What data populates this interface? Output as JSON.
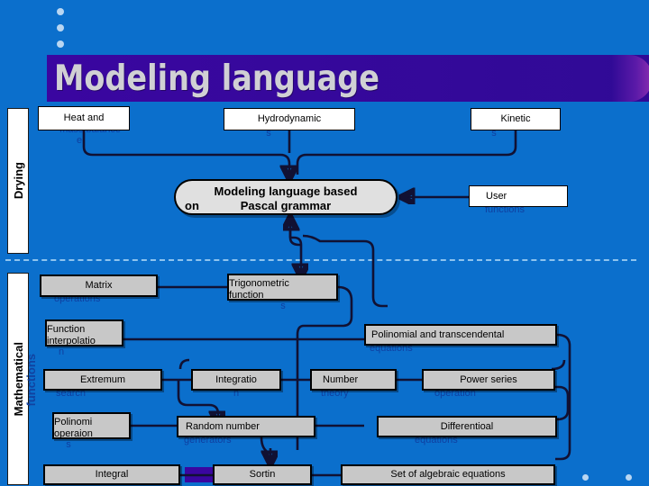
{
  "slide": {
    "title": "Modeling language",
    "background_color": "#0b6fcc",
    "title_band_color": "#300a96",
    "title_text_color": "#d0d0d4"
  },
  "sections": {
    "drying_label": "Drying",
    "math_label": "Mathematical",
    "math_label_overflow": "functions"
  },
  "top_row": [
    {
      "label": "Heat and",
      "overflow": "mass balance",
      "overflow2": "e"
    },
    {
      "label": "Hydrodynamic",
      "overflow": "s"
    },
    {
      "label": "Kinetic",
      "overflow": "s"
    }
  ],
  "center": {
    "line1": "Modeling language based",
    "line2": "Pascal grammar",
    "line2_prefix": "on"
  },
  "user_functions": {
    "label": "User",
    "overflow": "functions"
  },
  "math_boxes": [
    {
      "label": "Matrix",
      "overflow": "operations"
    },
    {
      "label": "Trigonometric",
      "label2": "function",
      "overflow": "s"
    },
    {
      "label": "Function",
      "label2": "interpolatio",
      "overflow": "n"
    },
    {
      "label": "Polinomial and transcendental",
      "overflow": "equations"
    },
    {
      "label": "Extremum",
      "overflow": "search"
    },
    {
      "label": "Integratio",
      "overflow": "n"
    },
    {
      "label": "Number",
      "overflow": "theory"
    },
    {
      "label": "Power series",
      "overflow": "operation"
    },
    {
      "label": "Polinomi",
      "label2": "operaion",
      "overflow": "s"
    },
    {
      "label": "Random number",
      "overflow": "generators"
    },
    {
      "label": "Differentioal",
      "overflow": "equations"
    },
    {
      "label": "Integral",
      "overflow": ""
    },
    {
      "label": "Sortin",
      "overflow": ""
    },
    {
      "label": "Set of algebraic equations",
      "overflow": ""
    }
  ],
  "colors": {
    "box_fill_white": "#ffffff",
    "box_fill_grey": "#c8c8c8",
    "overflow_text": "#0f3fa0",
    "bullet": "#b9d6f2",
    "divider": "#8fc4ef"
  }
}
